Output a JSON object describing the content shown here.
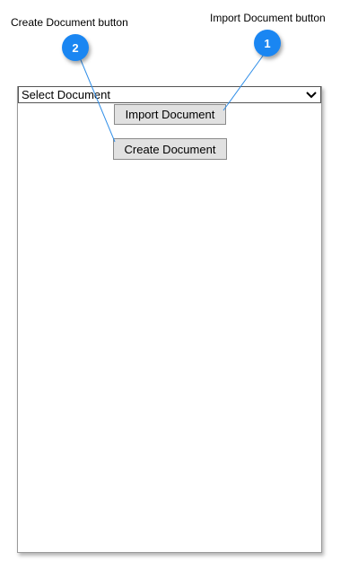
{
  "callouts": {
    "import": {
      "number": "1",
      "label": "Import Document button"
    },
    "create": {
      "number": "2",
      "label": "Create Document button"
    }
  },
  "form": {
    "select": {
      "value": "Select Document",
      "icon": "chevron-down-icon"
    },
    "import_button_label": "Import Document",
    "create_button_label": "Create Document"
  },
  "colors": {
    "badge": "#1a86f2",
    "connector": "#2f8ee8",
    "button_bg": "#e1e1e1"
  }
}
